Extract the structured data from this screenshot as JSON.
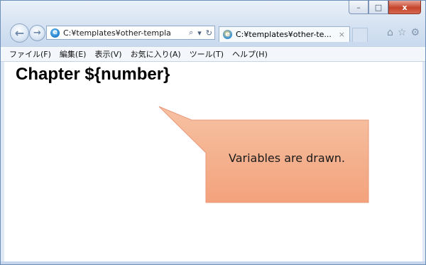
{
  "window": {
    "caption_buttons": {
      "minimize": "–",
      "maximize": "□",
      "close": "x"
    }
  },
  "nav": {
    "back_icon": "back-arrow-icon",
    "forward_icon": "forward-arrow-icon",
    "back_glyph": "←",
    "forward_glyph": "→"
  },
  "address_bar": {
    "url": "C:¥templates¥other-templa",
    "search_glyph": "⌕",
    "dropdown_glyph": "▾",
    "refresh_glyph": "↻",
    "favicon_glyph": "e"
  },
  "tab": {
    "title": "C:¥templates¥other-te...",
    "close_glyph": "×",
    "favicon_glyph": "e"
  },
  "toolbar_icons": {
    "home_glyph": "⌂",
    "favorites_glyph": "☆",
    "tools_glyph": "⚙"
  },
  "menu": [
    "ファイル(F)",
    "編集(E)",
    "表示(V)",
    "お気に入り(A)",
    "ツール(T)",
    "ヘルプ(H)"
  ],
  "page": {
    "title": "Chapter ${number}",
    "callout_text": "Variables are drawn."
  },
  "colors": {
    "callout_fill_top": "#f6c2a3",
    "callout_fill_bottom": "#f3a27c",
    "callout_stroke": "#e9987a"
  }
}
